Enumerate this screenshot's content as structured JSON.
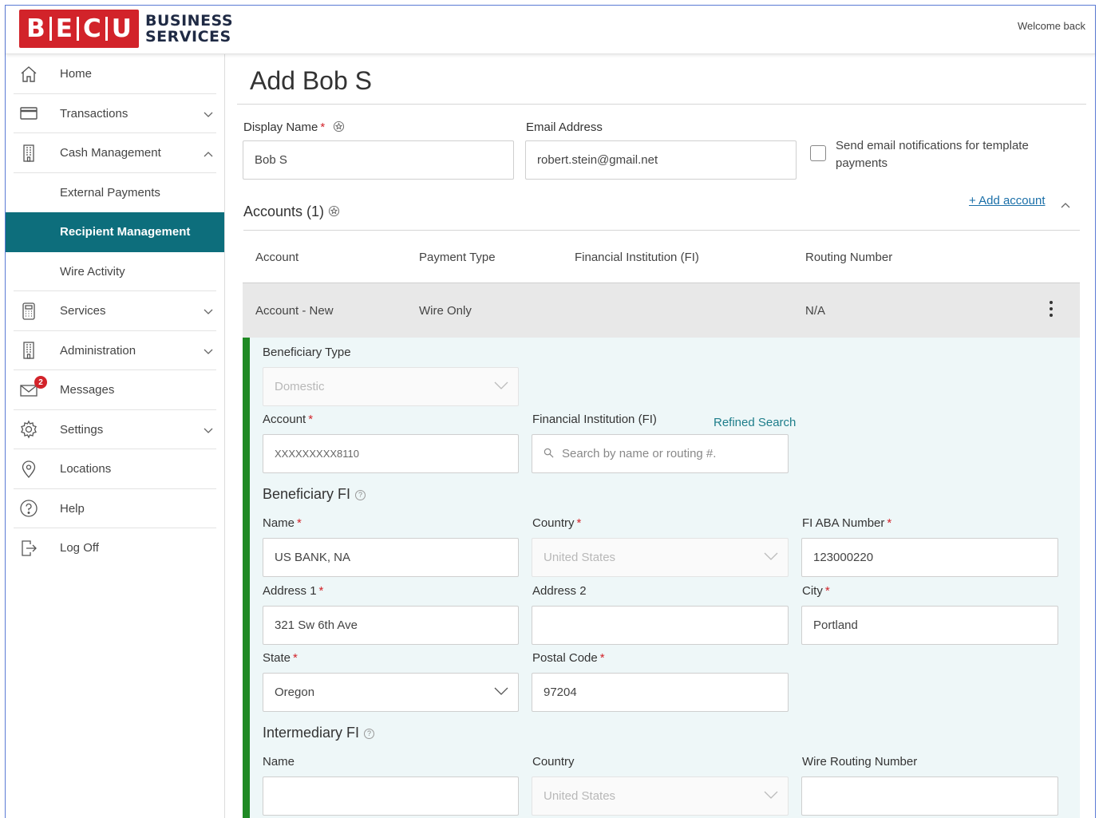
{
  "header": {
    "logo_letters": [
      "B",
      "E",
      "C",
      "U"
    ],
    "logo_line1": "BUSINESS",
    "logo_line2": "SERVICES",
    "welcome": "Welcome back"
  },
  "sidebar": {
    "items": [
      {
        "label": "Home",
        "icon": "home-icon"
      },
      {
        "label": "Transactions",
        "icon": "card-icon"
      },
      {
        "label": "Cash Management",
        "icon": "building-icon"
      },
      {
        "label": "External Payments"
      },
      {
        "label": "Recipient Management"
      },
      {
        "label": "Wire Activity"
      },
      {
        "label": "Services",
        "icon": "calculator-icon"
      },
      {
        "label": "Administration",
        "icon": "building-icon"
      },
      {
        "label": "Messages",
        "icon": "mail-icon",
        "badge": "2"
      },
      {
        "label": "Settings",
        "icon": "gear-icon"
      },
      {
        "label": "Locations",
        "icon": "location-pin-icon"
      },
      {
        "label": "Help",
        "icon": "help-icon"
      },
      {
        "label": "Log Off",
        "icon": "logout-icon"
      }
    ],
    "active_color": "#0d6e7c"
  },
  "form": {
    "title": "Add Bob S",
    "display_name_label": "Display Name",
    "display_name_value": "Bob S",
    "email_label": "Email Address",
    "email_value": "robert.stein@gmail.net",
    "notify_label": "Send email notifications for template payments",
    "accounts_title": "Accounts (1)",
    "add_account": "+ Add account"
  },
  "table": {
    "headers": [
      "Account",
      "Payment Type",
      "Financial Institution (FI)",
      "Routing Number"
    ],
    "row": {
      "account": "Account - New",
      "payment_type": "Wire Only",
      "fi": "",
      "routing": "N/A"
    }
  },
  "detail": {
    "beneficiary_type_label": "Beneficiary Type",
    "beneficiary_type_value": "Domestic",
    "account_label": "Account",
    "account_value": "XXXXXXXXX8110",
    "fi_label": "Financial Institution (FI)",
    "refined_search": "Refined Search",
    "fi_search_placeholder": "Search by name or routing #.",
    "beneficiary_fi_title": "Beneficiary FI",
    "name_label": "Name",
    "name_value": "US BANK, NA",
    "country_label": "Country",
    "country_value": "United States",
    "aba_label": "FI ABA Number",
    "aba_value": "123000220",
    "address1_label": "Address 1",
    "address1_value": "321 Sw 6th Ave",
    "address2_label": "Address 2",
    "address2_value": "",
    "city_label": "City",
    "city_value": "Portland",
    "state_label": "State",
    "state_value": "Oregon",
    "postal_label": "Postal Code",
    "postal_value": "97204",
    "intermediary_title": "Intermediary FI",
    "int_name_label": "Name",
    "int_country_label": "Country",
    "int_country_value": "United States",
    "int_routing_label": "Wire Routing Number"
  },
  "colors": {
    "brand_red": "#d2232a",
    "teal": "#0d6e7c",
    "green_bar": "#1f8a24",
    "link": "#1a6fa8"
  }
}
